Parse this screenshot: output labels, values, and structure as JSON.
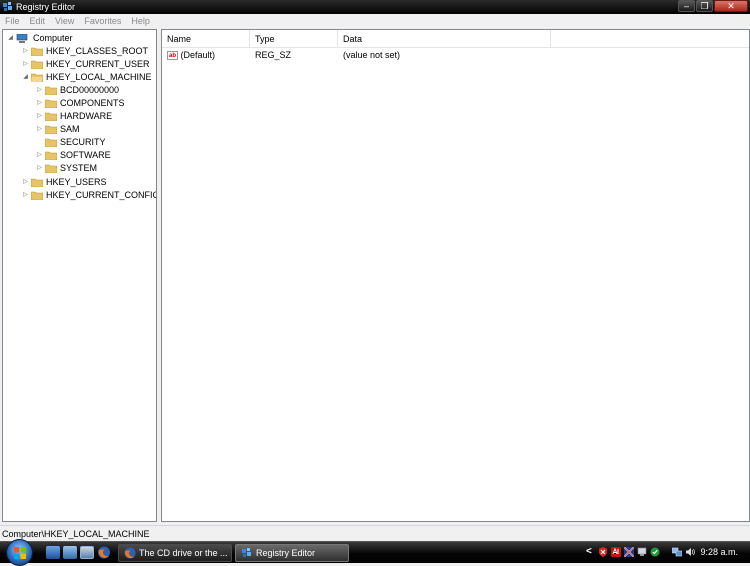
{
  "window": {
    "title": "Registry Editor",
    "minimize_glyph": "–",
    "maximize_glyph": "❐",
    "close_glyph": "✕"
  },
  "menu": [
    "File",
    "Edit",
    "View",
    "Favorites",
    "Help"
  ],
  "tree": {
    "root": "Computer",
    "hives": [
      "HKEY_CLASSES_ROOT",
      "HKEY_CURRENT_USER",
      "HKEY_LOCAL_MACHINE",
      "HKEY_USERS",
      "HKEY_CURRENT_CONFIG"
    ],
    "hklm_children": [
      "BCD00000000",
      "COMPONENTS",
      "HARDWARE",
      "SAM",
      "SECURITY",
      "SOFTWARE",
      "SYSTEM"
    ],
    "expanded_glyph": "◢",
    "collapsed_glyph": "▷"
  },
  "list": {
    "columns": [
      "Name",
      "Type",
      "Data"
    ],
    "rows": [
      {
        "icon": "ab",
        "name": "(Default)",
        "type": "REG_SZ",
        "data": "(value not set)"
      }
    ]
  },
  "status": {
    "path": "Computer\\HKEY_LOCAL_MACHINE"
  },
  "taskbar": {
    "buttons": [
      "The CD drive or the ...",
      "Registry Editor"
    ],
    "tray_arrow": "<",
    "clock": "9:28 a.m."
  },
  "colors": {
    "folder": "#e8c468",
    "titlebar": "#000000",
    "taskbar": "#111111",
    "accent_blue": "#2a6bbd"
  }
}
